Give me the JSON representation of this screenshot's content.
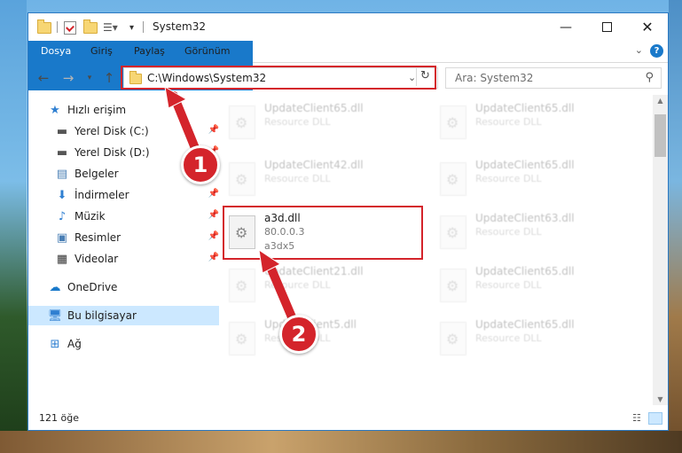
{
  "window": {
    "title": "System32",
    "tabs": {
      "file": "Dosya",
      "home": "Giriş",
      "share": "Paylaş",
      "view": "Görünüm"
    },
    "help": "?"
  },
  "address": {
    "path": "C:\\Windows\\System32",
    "search_placeholder": "Ara: System32"
  },
  "sidebar": {
    "items": [
      {
        "label": "Hızlı erişim",
        "icon": "star-icon"
      },
      {
        "label": "Yerel Disk (C:)",
        "icon": "drive-icon"
      },
      {
        "label": "Yerel Disk (D:)",
        "icon": "drive-icon"
      },
      {
        "label": "Belgeler",
        "icon": "documents-icon"
      },
      {
        "label": "İndirmeler",
        "icon": "download-icon"
      },
      {
        "label": "Müzik",
        "icon": "music-icon"
      },
      {
        "label": "Resimler",
        "icon": "pictures-icon"
      },
      {
        "label": "Videolar",
        "icon": "videos-icon"
      },
      {
        "label": "OneDrive",
        "icon": "cloud-icon"
      },
      {
        "label": "Bu bilgisayar",
        "icon": "computer-icon"
      },
      {
        "label": "Ağ",
        "icon": "network-icon"
      }
    ]
  },
  "files": {
    "left": [
      {
        "name": "UpdateClient65.dll",
        "desc": "Resource DLL"
      },
      {
        "name": "UpdateClient42.dll",
        "desc": "Resource DLL"
      },
      {
        "name": "a3d.dll",
        "desc": "80.0.0.3",
        "desc2": "a3dx5"
      },
      {
        "name": "UpdateClient21.dll",
        "desc": "Resource DLL"
      },
      {
        "name": "UpdateClient5.dll",
        "desc": "Resource DLL"
      }
    ],
    "right": [
      {
        "name": "UpdateClient65.dll",
        "desc": "Resource DLL"
      },
      {
        "name": "UpdateClient65.dll",
        "desc": "Resource DLL"
      },
      {
        "name": "UpdateClient63.dll",
        "desc": "Resource DLL"
      },
      {
        "name": "UpdateClient65.dll",
        "desc": "Resource DLL"
      },
      {
        "name": "UpdateClient65.dll",
        "desc": "Resource DLL"
      }
    ]
  },
  "status": {
    "count": "121 öğe"
  },
  "annotations": {
    "step1": "1",
    "step2": "2",
    "color": "#d4242b"
  }
}
